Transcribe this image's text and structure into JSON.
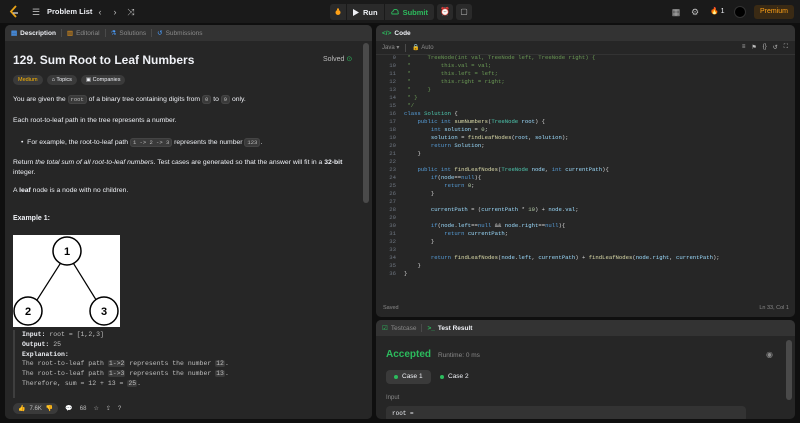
{
  "topbar": {
    "problem_list": "Problem List",
    "run": "Run",
    "submit": "Submit",
    "streak": "1",
    "premium": "Premium"
  },
  "description_panel": {
    "tabs": [
      {
        "label": "Description",
        "icon": "document-icon"
      },
      {
        "label": "Editorial",
        "icon": "book-icon"
      },
      {
        "label": "Solutions",
        "icon": "flask-icon"
      },
      {
        "label": "Submissions",
        "icon": "history-icon"
      }
    ],
    "title": "129. Sum Root to Leaf Numbers",
    "status": "Solved",
    "badges": {
      "difficulty": "Medium",
      "topics": "Topics",
      "companies": "Companies"
    },
    "para1_a": "You are given the",
    "para1_code": "root",
    "para1_b": "of a binary tree containing digits from",
    "para1_c0": "0",
    "para1_to": "to",
    "para1_c9": "9",
    "para1_end": "only.",
    "para2": "Each root-to-leaf path in the tree represents a number.",
    "bullet_a": "For example, the root-to-leaf path",
    "bullet_code": "1 -> 2 -> 3",
    "bullet_b": "represents the number",
    "bullet_num": "123",
    "bullet_end": ".",
    "para3_a": "Return",
    "para3_em": "the total sum of all root-to-leaf numbers",
    "para3_b": ". Test cases are generated so that the answer will fit in a",
    "para3_bold": "32-bit",
    "para3_line2": "integer.",
    "para4_a": "A",
    "para4_bold": "leaf",
    "para4_b": "node is a node with no children.",
    "example_title": "Example 1:",
    "tree_nodes": {
      "root": "1",
      "left": "2",
      "right": "3"
    },
    "example": {
      "input_label": "Input:",
      "input_value": "root = [1,2,3]",
      "output_label": "Output:",
      "output_value": "25",
      "explanation_label": "Explanation:",
      "lines": [
        {
          "pre": "The root-to-leaf path ",
          "code": "1->2",
          "mid": " represents the number ",
          "num": "12",
          "post": "."
        },
        {
          "pre": "The root-to-leaf path ",
          "code": "1->3",
          "mid": " represents the number ",
          "num": "13",
          "post": "."
        },
        {
          "pre": "Therefore, sum = 12 + 13 = ",
          "code": "",
          "mid": "",
          "num": "25",
          "post": "."
        }
      ]
    },
    "footer": {
      "likes": "7.6K",
      "comments": "68"
    }
  },
  "code_panel": {
    "title": "Code",
    "language": "Java",
    "mode": "Auto",
    "status_left": "Saved",
    "status_right": "Ln 33, Col 1"
  },
  "result_panel": {
    "tabs": [
      {
        "label": "Testcase"
      },
      {
        "label": "Test Result"
      }
    ],
    "verdict": "Accepted",
    "runtime": "Runtime: 0 ms",
    "cases": [
      "Case 1",
      "Case 2"
    ],
    "input_label": "Input",
    "input_value": "root ="
  },
  "colors": {
    "accent": "#ffa116",
    "success": "#2cbb5d",
    "medium": "#ffb800"
  }
}
